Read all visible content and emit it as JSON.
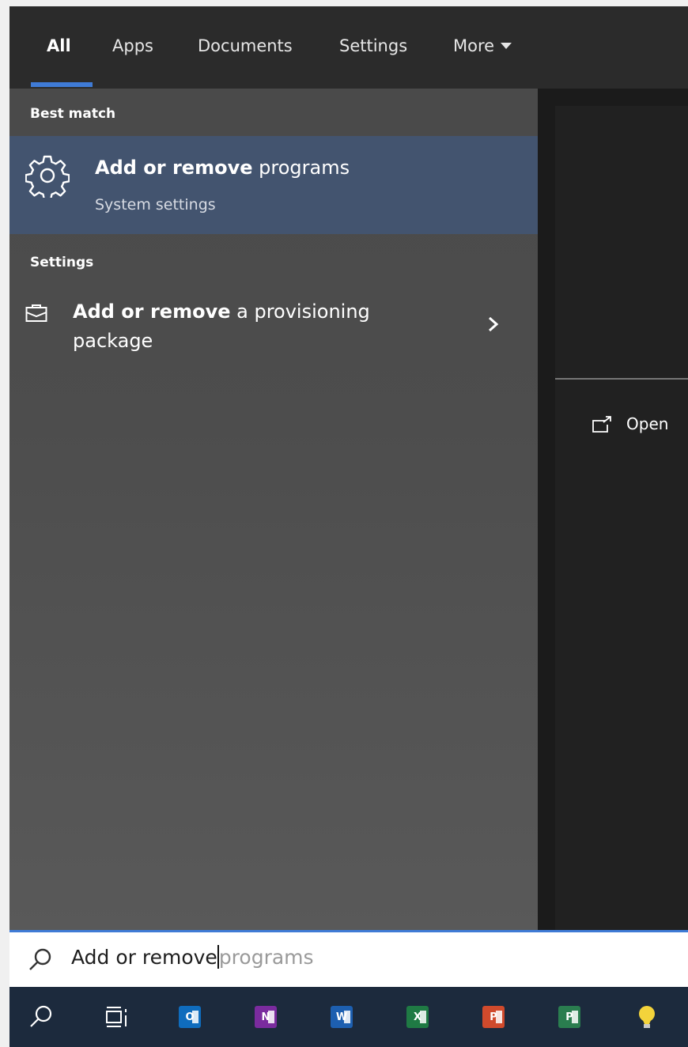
{
  "tabs": [
    {
      "label": "All",
      "active": true
    },
    {
      "label": "Apps"
    },
    {
      "label": "Documents"
    },
    {
      "label": "Settings"
    },
    {
      "label": "More"
    }
  ],
  "results": {
    "best_match_heading": "Best match",
    "best_match": {
      "title_bold": "Add or remove",
      "title_rest": " programs",
      "subtitle": "System settings",
      "icon": "gear-icon"
    },
    "settings_heading": "Settings",
    "settings_items": [
      {
        "title_bold": "Add or remove",
        "title_rest": " a provisioning package",
        "icon": "package-icon"
      }
    ]
  },
  "preview": {
    "open_label": "Open",
    "icon": "open-icon"
  },
  "search": {
    "typed": "Add or remove",
    "suggestion": "programs"
  },
  "taskbar": [
    {
      "name": "search-icon"
    },
    {
      "name": "task-view-icon"
    },
    {
      "letter": "O",
      "app": "outlook",
      "color": "#0f6cbd"
    },
    {
      "letter": "N",
      "app": "onenote",
      "color": "#7a2b9e"
    },
    {
      "letter": "W",
      "app": "word",
      "color": "#1d5fb0"
    },
    {
      "letter": "X",
      "app": "excel",
      "color": "#1f7a44"
    },
    {
      "letter": "P",
      "app": "powerpoint",
      "color": "#d04a2c"
    },
    {
      "letter": "P",
      "app": "project",
      "color": "#2a7d4f"
    },
    {
      "name": "lightbulb-icon"
    }
  ],
  "colors": {
    "accent": "#3f7bd6",
    "selection": "#43546f"
  }
}
